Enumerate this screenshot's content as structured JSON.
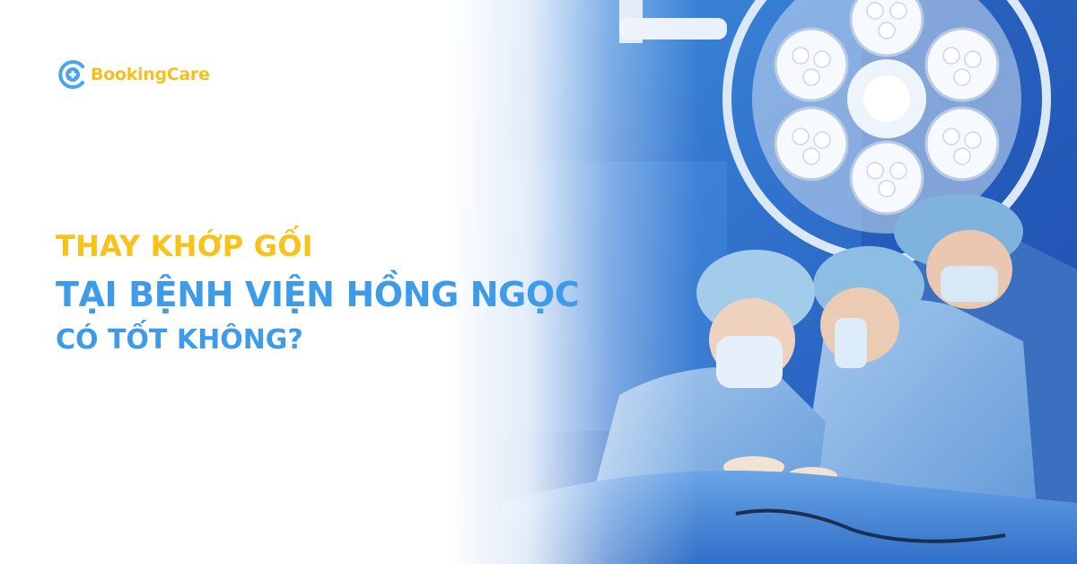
{
  "brand": {
    "name": "BookingCare",
    "colors": {
      "yellow": "#f7c21a",
      "blue": "#3d9bea"
    },
    "logo_icon": "plus-in-ring-icon"
  },
  "headline": {
    "line1": "THAY KHỚP GỐI",
    "line2": "TẠI BỆNH VIỆN HỒNG NGỌC",
    "line3": "CÓ TỐT KHÔNG?"
  },
  "photo": {
    "subject": "surgery-photo"
  }
}
